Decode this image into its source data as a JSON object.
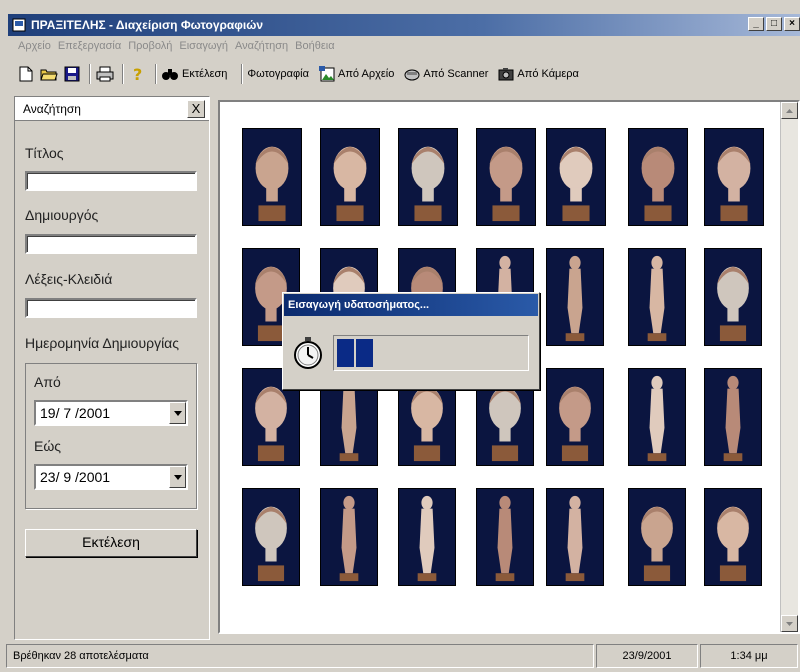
{
  "window": {
    "title": "ΠΡΑΞΙΤΕΛΗΣ - Διαχείριση Φωτογραφιών"
  },
  "menu": [
    "Αρχείο",
    "Επεξεργασία",
    "Προβολή",
    "Εισαγωγή",
    "Αναζήτηση",
    "Βοήθεια"
  ],
  "toolbar": {
    "run_label": "Εκτέλεση",
    "photo_label": "Φωτογραφία",
    "from_file_label": "Από Αρχείο",
    "from_scanner_label": "Από Scanner",
    "from_camera_label": "Από Κάμερα"
  },
  "search_panel": {
    "title": "Αναζήτηση",
    "close_label": "X",
    "title_label": "Τίτλος",
    "title_value": "",
    "creator_label": "Δημιουργός",
    "creator_value": "",
    "keywords_label": "Λέξεις-Κλειδιά",
    "keywords_value": "",
    "date_label": "Ημερομηνία Δημιουργίας",
    "from_label": "Από",
    "from_value": "19/ 7 /2001",
    "to_label": "Εώς",
    "to_value": "23/ 9 /2001",
    "run_button": "Εκτέλεση"
  },
  "dialog": {
    "title": "Εισαγωγή υδατοσήματος...",
    "progress_percent": 18
  },
  "statusbar": {
    "results": "Βρέθηκαν 28 αποτελέσματα",
    "date": "23/9/2001",
    "time": "1:34 μμ"
  },
  "colors": {
    "title_bar": "#1f3f7a",
    "thumb_bg": "#0b1540",
    "progress": "#0a2a86"
  },
  "gallery": {
    "count": 28
  }
}
